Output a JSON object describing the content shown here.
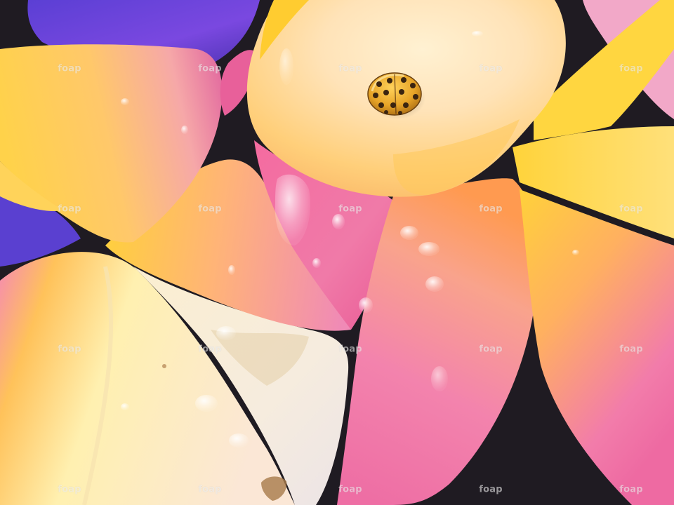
{
  "image": {
    "subject": "ladybug-on-plumeria-flowers",
    "watermark_text": "foap",
    "palette": {
      "petal_yellow": "#ffd43a",
      "petal_pink": "#f06aa0",
      "petal_orange": "#ff9a3c",
      "petal_cream": "#ffe9c8",
      "background_purple": "#6a3cd8",
      "shadow_dark": "#201c24",
      "ladybug_body": "#e8a528",
      "ladybug_spots": "#3a2410"
    }
  }
}
